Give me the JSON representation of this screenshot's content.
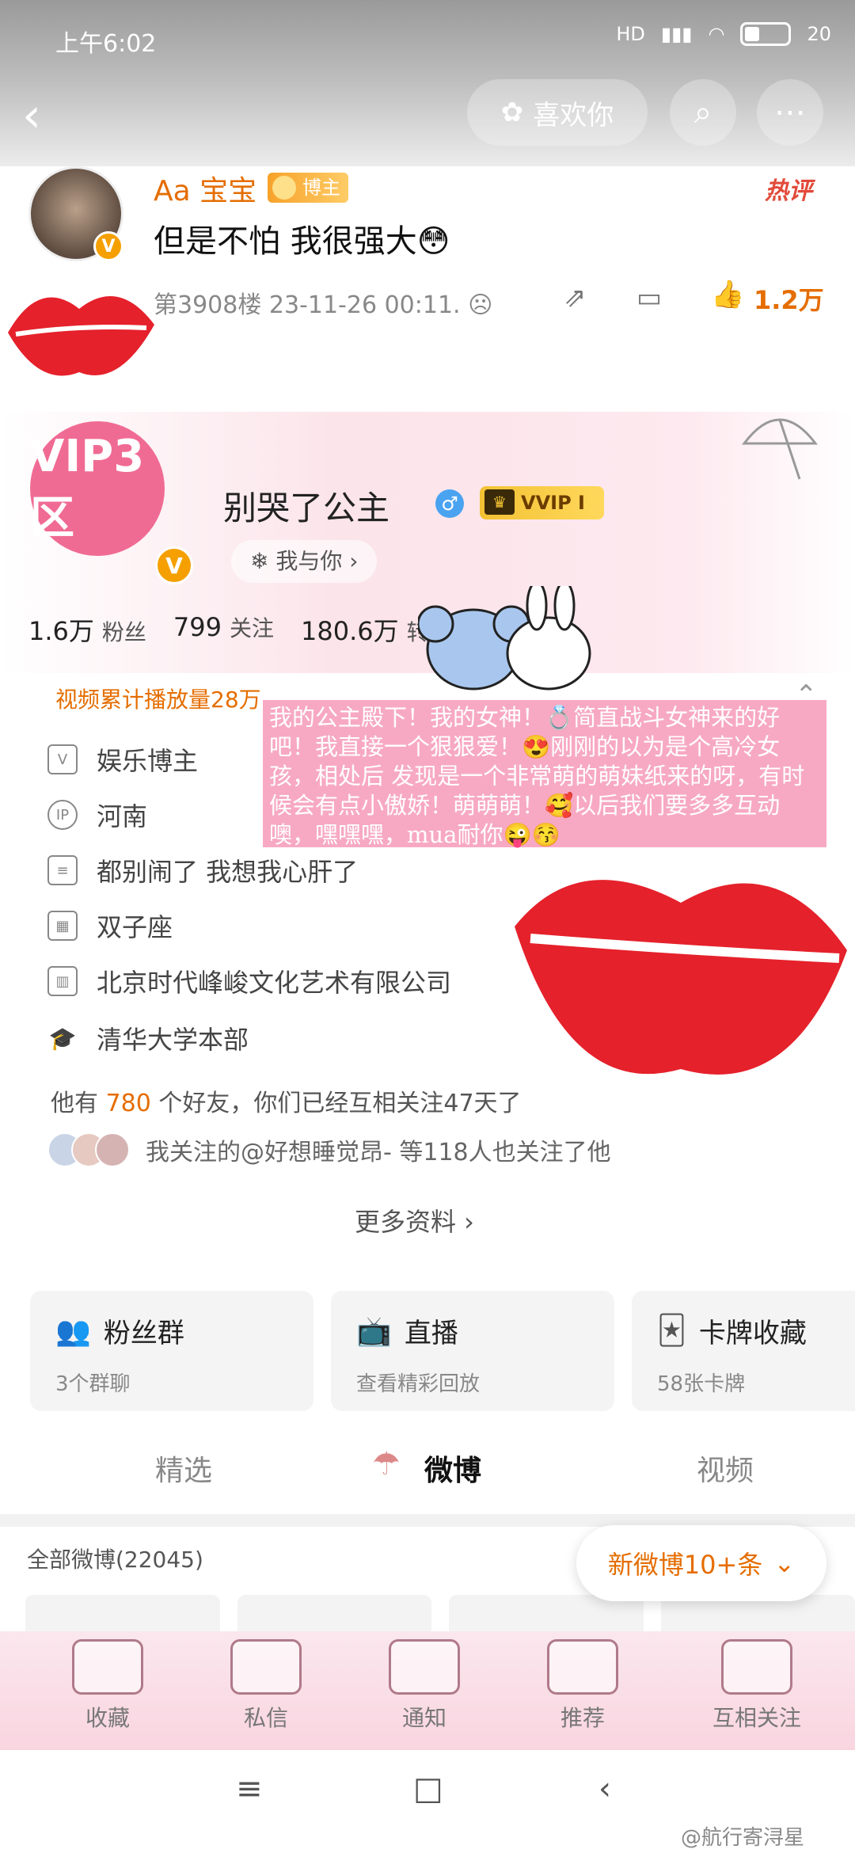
{
  "status_bar": {
    "time": "上午6:02",
    "network": "HD",
    "battery": "20"
  },
  "header": {
    "like_button_label": "喜欢你"
  },
  "comment": {
    "username": "Aa 宝宝",
    "badge": "博主",
    "hot_label": "热评",
    "text": "但是不怕 我很强大",
    "emoji": "😳",
    "meta": "第3908楼 23-11-26 00:11.",
    "like_count": "1.2万"
  },
  "profile": {
    "avatar_text": "VIP3区",
    "name": "别哭了公主",
    "gender_symbol": "♂",
    "vip_label": "VVIP I",
    "follow_tag": "❄ 我与你 ›",
    "stats": {
      "fans_value": "1.6万",
      "fans_label": "粉丝",
      "following_value": "799",
      "following_label": "关注",
      "posts_value": "180.6万",
      "posts_label": "转"
    },
    "video_views": "视频累计播放量28万",
    "info": [
      {
        "icon": "V",
        "text": "娱乐博主"
      },
      {
        "icon": "IP",
        "text": "河南"
      },
      {
        "icon": "≡",
        "text": "都别闹了 我想我心肝了"
      },
      {
        "icon": "▦",
        "text": "双子座"
      },
      {
        "icon": "▥",
        "text": "北京时代峰峻文化艺术有限公司"
      },
      {
        "icon": "🎓",
        "text": "清华大学本部"
      }
    ],
    "friends_prefix": "他有",
    "friends_count": "780",
    "friends_suffix": "个好友，你们已经互相关注47天了",
    "mutual": "我关注的@好想睡觉昂- 等118人也关注了他",
    "more": "更多资料 ›"
  },
  "overlay_text": "我的公主殿下！我的女神！💍简直战斗女神来的好吧！我直接一个狠狠爱！😍刚刚的以为是个高冷女孩，相处后 发现是一个非常萌的萌妹纸来的呀，有时候会有点小傲娇！萌萌萌！🥰以后我们要多多互动噢，嘿嘿嘿，mua耐你😜😚",
  "cards": [
    {
      "icon": "👥",
      "title": "粉丝群",
      "sub": "3个群聊"
    },
    {
      "icon": "📺",
      "title": "直播",
      "sub": "查看精彩回放"
    },
    {
      "icon": "🃏",
      "title": "卡牌收藏",
      "sub": "58张卡牌"
    }
  ],
  "tabs": [
    "精选",
    "微博",
    "视频"
  ],
  "all_weibo": "全部微博(22045)",
  "new_weibo": "新微博10+条",
  "bottom_tabs": [
    "收藏",
    "私信",
    "通知",
    "推荐",
    "互相关注"
  ],
  "nav": {
    "menu": "≡",
    "home": "□",
    "back": "‹"
  },
  "watermark": "@航行寄浔星"
}
